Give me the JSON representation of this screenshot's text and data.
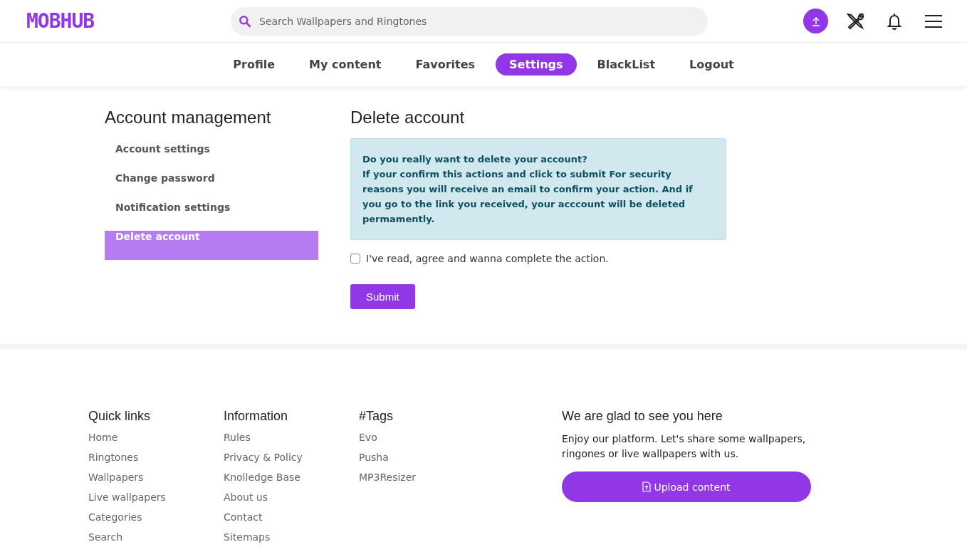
{
  "header": {
    "logo": "MOBHUB",
    "search": {
      "placeholder": "Search Wallpapers and Ringtones"
    }
  },
  "tabs": [
    {
      "label": "Profile",
      "selected": false
    },
    {
      "label": "My content",
      "selected": false
    },
    {
      "label": "Favorites",
      "selected": false
    },
    {
      "label": "Settings",
      "selected": true
    },
    {
      "label": "BlackList",
      "selected": false
    },
    {
      "label": "Logout",
      "selected": false
    }
  ],
  "sidebar": {
    "title": "Account management",
    "items": [
      {
        "label": "Account settings",
        "selected": false
      },
      {
        "label": "Change password",
        "selected": false
      },
      {
        "label": "Notification settings",
        "selected": false
      },
      {
        "label": "Delete account",
        "selected": true
      }
    ]
  },
  "content": {
    "title": "Delete account",
    "alert": {
      "title": "Do you really want to delete your account?",
      "body": "If your confirm this actions and click to submit For security reasons you will receive an email to confirm your action. And if you go to the link you received, your acccount will be deleted permamently."
    },
    "agree": {
      "label": "I've read, agree and wanna complete the action.",
      "checked": false
    },
    "submit": "Submit"
  },
  "footer": {
    "columns": [
      {
        "title": "Quick links",
        "links": [
          "Home",
          "Ringtones",
          "Wallpapers",
          "Live wallpapers",
          "Categories",
          "Search"
        ]
      },
      {
        "title": "Information",
        "links": [
          "Rules",
          "Privacy & Policy",
          "Knolledge Base",
          "About us",
          "Contact",
          "Sitemaps"
        ]
      },
      {
        "title": "#Tags",
        "links": [
          "Evo",
          "Pusha",
          "MP3Resizer"
        ]
      }
    ],
    "welcome": {
      "title": "We are glad to see you here",
      "text": "Enjoy our platform. Let's share some wallpapers, ringones or live wallpapers with us.",
      "button": "Upload content"
    }
  }
}
